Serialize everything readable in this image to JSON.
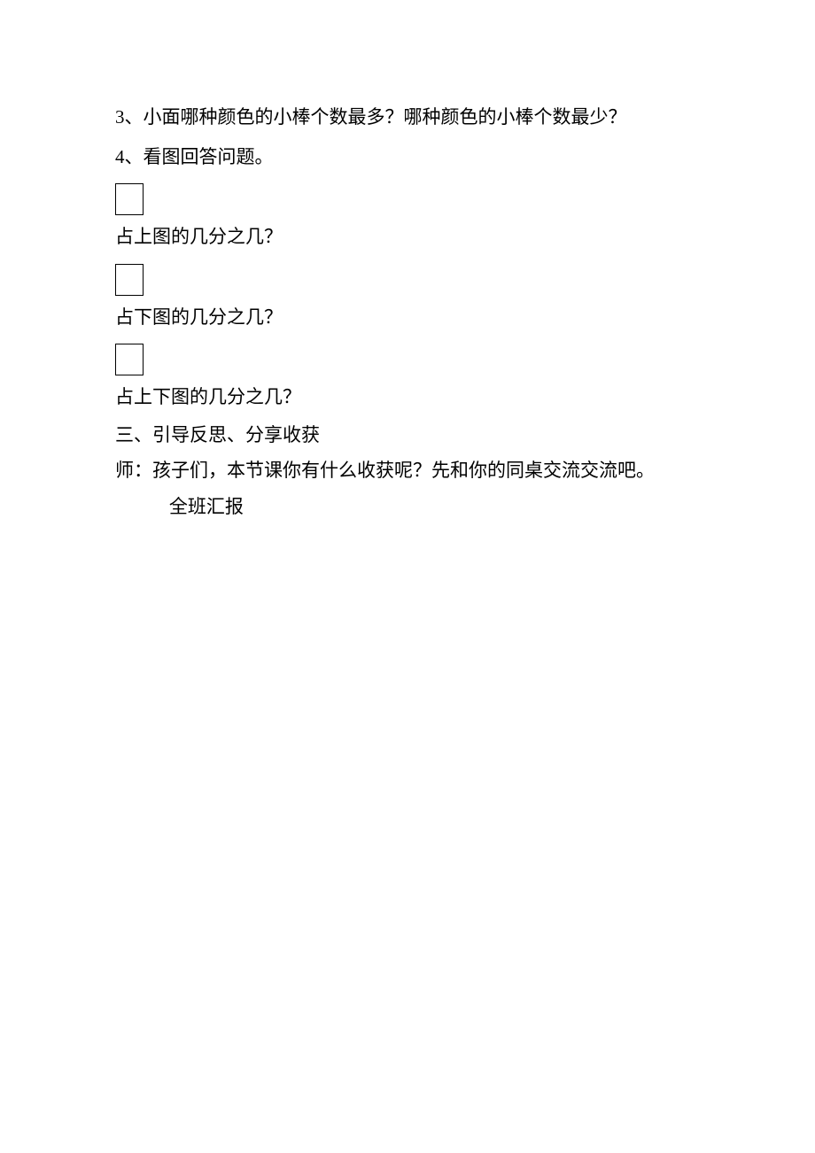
{
  "q3": "3、小面哪种颜色的小棒个数最多？哪种颜色的小棒个数最少？",
  "q4_intro": "4、看图回答问题。",
  "q4_items": [
    "占上图的几分之几？",
    "占下图的几分之几？",
    "占上下图的几分之几？"
  ],
  "section3_title": "三、引导反思、分享收获",
  "teacher_line": "师：孩子们，本节课你有什么收获呢？先和你的同桌交流交流吧。",
  "class_report": "全班汇报"
}
